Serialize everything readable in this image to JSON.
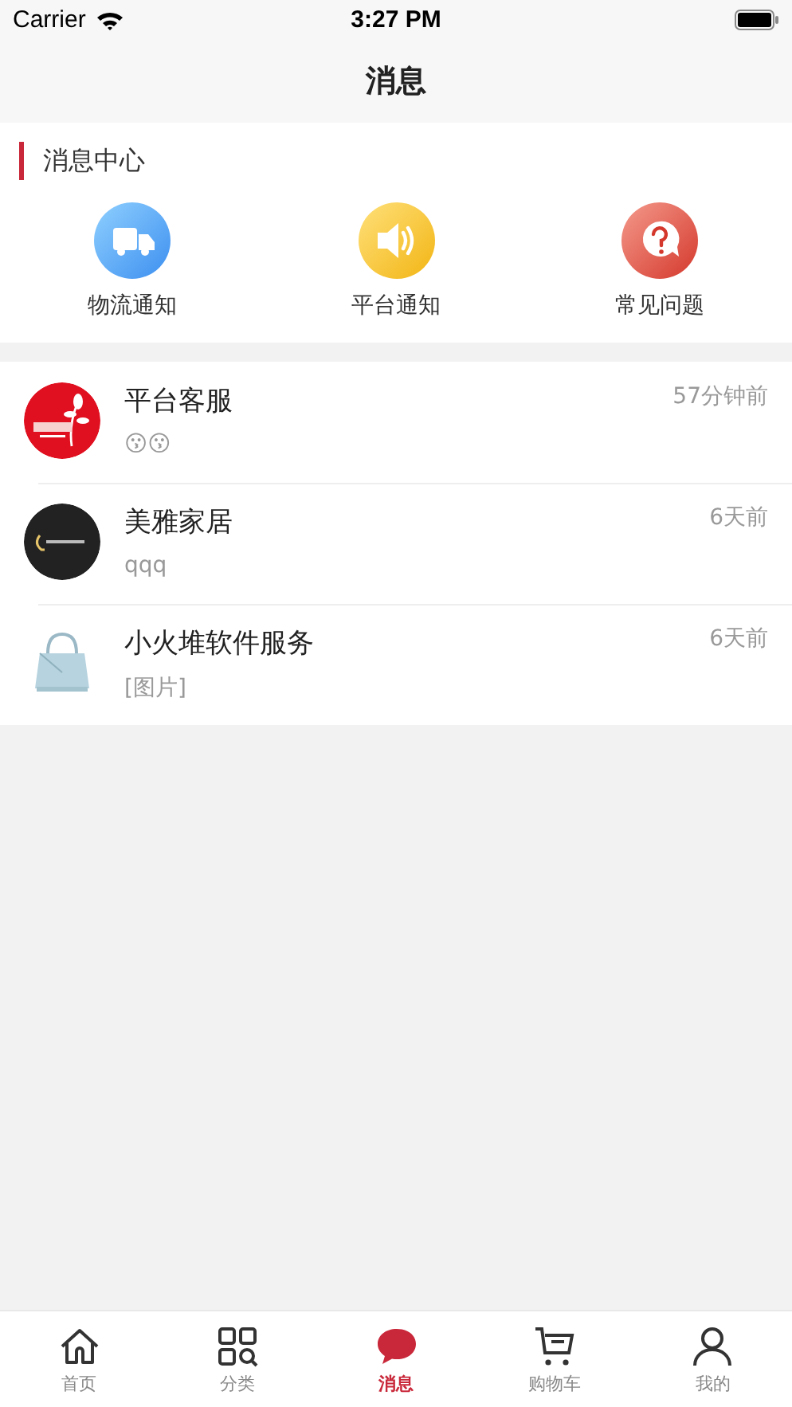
{
  "status_bar": {
    "carrier": "Carrier",
    "time": "3:27 PM"
  },
  "nav": {
    "title": "消息"
  },
  "message_center": {
    "title": "消息中心",
    "shortcuts": [
      {
        "kind": "truck",
        "label": "物流通知"
      },
      {
        "kind": "speaker",
        "label": "平台通知"
      },
      {
        "kind": "question",
        "label": "常见问题"
      }
    ]
  },
  "conversations": [
    {
      "name": "平台客服",
      "time": "57分钟前",
      "preview": "😗😗"
    },
    {
      "name": "美雅家居",
      "time": "6天前",
      "preview": "qqq"
    },
    {
      "name": "小火堆软件服务",
      "time": "6天前",
      "preview": "[图片]"
    }
  ],
  "tab_bar": [
    {
      "kind": "home",
      "label": "首页",
      "selected": false
    },
    {
      "kind": "category",
      "label": "分类",
      "selected": false
    },
    {
      "kind": "message",
      "label": "消息",
      "selected": true
    },
    {
      "kind": "cart",
      "label": "购物车",
      "selected": false
    },
    {
      "kind": "profile",
      "label": "我的",
      "selected": false
    }
  ]
}
